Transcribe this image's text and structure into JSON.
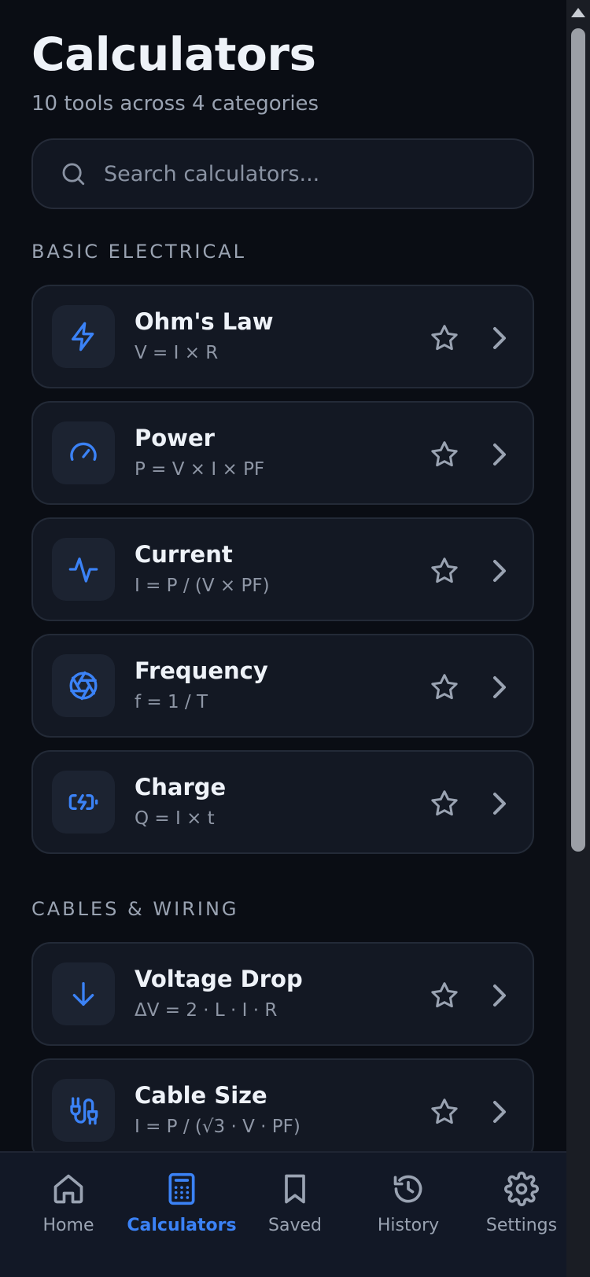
{
  "header": {
    "title": "Calculators",
    "subtitle": "10 tools across 4 categories"
  },
  "search": {
    "placeholder": "Search calculators...",
    "value": ""
  },
  "colors": {
    "accent": "#3b82f6",
    "background": "#0a0d14",
    "card": "#131823",
    "muted": "#8f97a6"
  },
  "sections": [
    {
      "label": "BASIC ELECTRICAL",
      "items": [
        {
          "name": "Ohm's Law",
          "formula": "V = I × R",
          "icon": "lightning-bolt-icon"
        },
        {
          "name": "Power",
          "formula": "P = V × I × PF",
          "icon": "gauge-icon"
        },
        {
          "name": "Current",
          "formula": "I = P / (V × PF)",
          "icon": "activity-icon"
        },
        {
          "name": "Frequency",
          "formula": "f = 1 / T",
          "icon": "aperture-icon"
        },
        {
          "name": "Charge",
          "formula": "Q = I × t",
          "icon": "battery-charging-icon"
        }
      ]
    },
    {
      "label": "CABLES & WIRING",
      "items": [
        {
          "name": "Voltage Drop",
          "formula": "ΔV = 2 · L · I · R",
          "icon": "arrow-down-icon"
        },
        {
          "name": "Cable Size",
          "formula": "I = P / (√3 · V · PF)",
          "icon": "cable-plug-icon"
        }
      ]
    }
  ],
  "tabbar": {
    "active": "Calculators",
    "tabs": [
      {
        "label": "Home",
        "icon": "home-icon"
      },
      {
        "label": "Calculators",
        "icon": "calculator-icon"
      },
      {
        "label": "Saved",
        "icon": "bookmark-icon"
      },
      {
        "label": "History",
        "icon": "history-icon"
      },
      {
        "label": "Settings",
        "icon": "gear-icon"
      }
    ]
  }
}
